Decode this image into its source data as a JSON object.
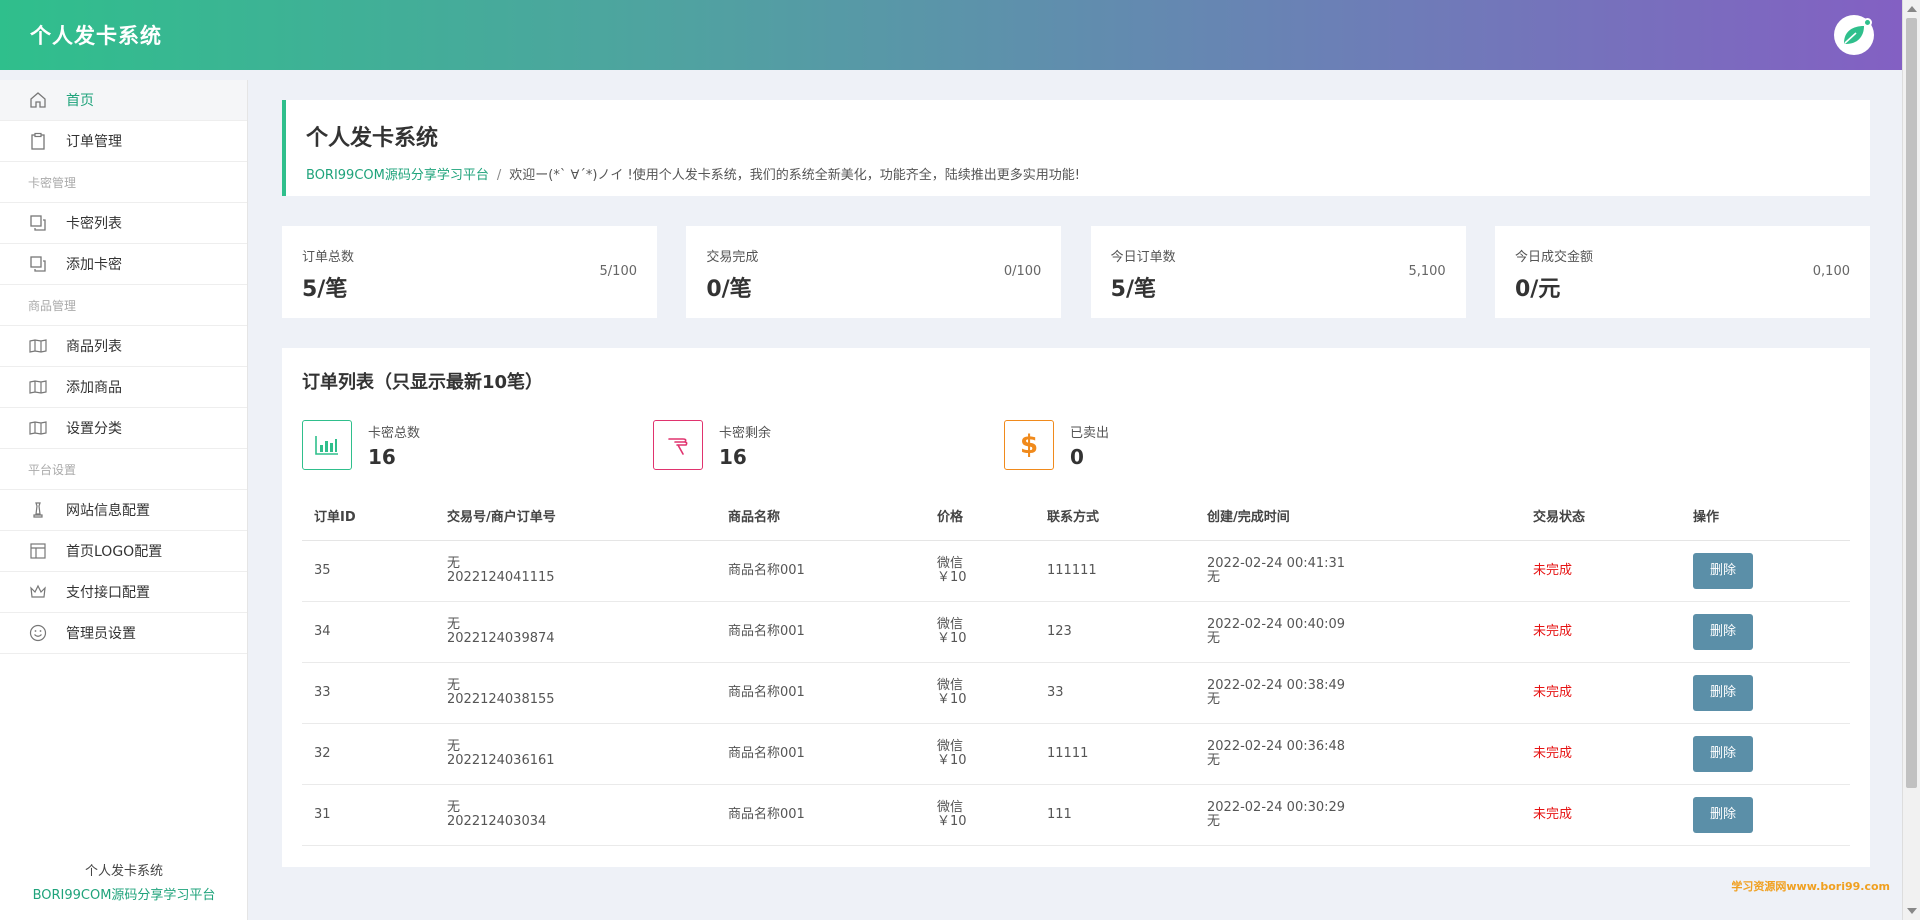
{
  "header": {
    "title": "个人发卡系统"
  },
  "sidebar": {
    "items": [
      {
        "label": "首页",
        "active": true,
        "icon": "home-icon"
      },
      {
        "label": "订单管理",
        "icon": "clipboard-icon"
      }
    ],
    "sections": [
      {
        "title": "卡密管理",
        "items": [
          {
            "label": "卡密列表",
            "icon": "copy-icon"
          },
          {
            "label": "添加卡密",
            "icon": "copy-icon"
          }
        ]
      },
      {
        "title": "商品管理",
        "items": [
          {
            "label": "商品列表",
            "icon": "book-icon"
          },
          {
            "label": "添加商品",
            "icon": "book-icon"
          },
          {
            "label": "设置分类",
            "icon": "book-icon"
          }
        ]
      },
      {
        "title": "平台设置",
        "items": [
          {
            "label": "网站信息配置",
            "icon": "chess-icon"
          },
          {
            "label": "首页LOGO配置",
            "icon": "layout-icon"
          },
          {
            "label": "支付接口配置",
            "icon": "crown-icon"
          },
          {
            "label": "管理员设置",
            "icon": "smile-icon"
          }
        ]
      }
    ],
    "footer": {
      "line1": "个人发卡系统",
      "line2": "BORI99COM源码分享学习平台"
    }
  },
  "welcome": {
    "title": "个人发卡系统",
    "highlight": "BORI99COM源码分享学习平台",
    "separator": "/",
    "text": "欢迎ー(*ˋ ∀ˊ*)ノイ !使用个人发卡系统，我们的系统全新美化，功能齐全，陆续推出更多实用功能!"
  },
  "stats": [
    {
      "label": "订单总数",
      "value": "5/笔",
      "sub": "5/100"
    },
    {
      "label": "交易完成",
      "value": "0/笔",
      "sub": "0/100"
    },
    {
      "label": "今日订单数",
      "value": "5/笔",
      "sub": "5,100"
    },
    {
      "label": "今日成交金额",
      "value": "0/元",
      "sub": "0,100"
    }
  ],
  "orders": {
    "title": "订单列表（只显示最新10笔）",
    "summary": [
      {
        "label": "卡密总数",
        "value": "16",
        "color": "#2fbf8c",
        "icon": "bar-chart-icon"
      },
      {
        "label": "卡密剩余",
        "value": "16",
        "color": "#e0336e",
        "icon": "hand-icon"
      },
      {
        "label": "已卖出",
        "value": "0",
        "color": "#f08a1c",
        "icon": "dollar-icon"
      }
    ],
    "columns": [
      "订单ID",
      "交易号/商户订单号",
      "商品名称",
      "价格",
      "联系方式",
      "创建/完成时间",
      "交易状态",
      "操作"
    ],
    "rows": [
      {
        "id": "35",
        "trade": "无",
        "merchant": "2022124041115",
        "product": "商品名称001",
        "pay": "微信",
        "price": "￥10",
        "contact": "111111",
        "created": "2022-02-24 00:41:31",
        "finished": "无",
        "status": "未完成",
        "action": "删除"
      },
      {
        "id": "34",
        "trade": "无",
        "merchant": "2022124039874",
        "product": "商品名称001",
        "pay": "微信",
        "price": "￥10",
        "contact": "123",
        "created": "2022-02-24 00:40:09",
        "finished": "无",
        "status": "未完成",
        "action": "删除"
      },
      {
        "id": "33",
        "trade": "无",
        "merchant": "2022124038155",
        "product": "商品名称001",
        "pay": "微信",
        "price": "￥10",
        "contact": "33",
        "created": "2022-02-24 00:38:49",
        "finished": "无",
        "status": "未完成",
        "action": "删除"
      },
      {
        "id": "32",
        "trade": "无",
        "merchant": "2022124036161",
        "product": "商品名称001",
        "pay": "微信",
        "price": "￥10",
        "contact": "11111",
        "created": "2022-02-24 00:36:48",
        "finished": "无",
        "status": "未完成",
        "action": "删除"
      },
      {
        "id": "31",
        "trade": "无",
        "merchant": "202212403034",
        "product": "商品名称001",
        "pay": "微信",
        "price": "￥10",
        "contact": "111",
        "created": "2022-02-24 00:30:29",
        "finished": "无",
        "status": "未完成",
        "action": "删除"
      }
    ]
  },
  "watermark": "学习资源网www.bori99.com",
  "colors": {
    "accent": "#2fbf8c",
    "status_error": "#e61414",
    "button": "#5b8fa8"
  }
}
